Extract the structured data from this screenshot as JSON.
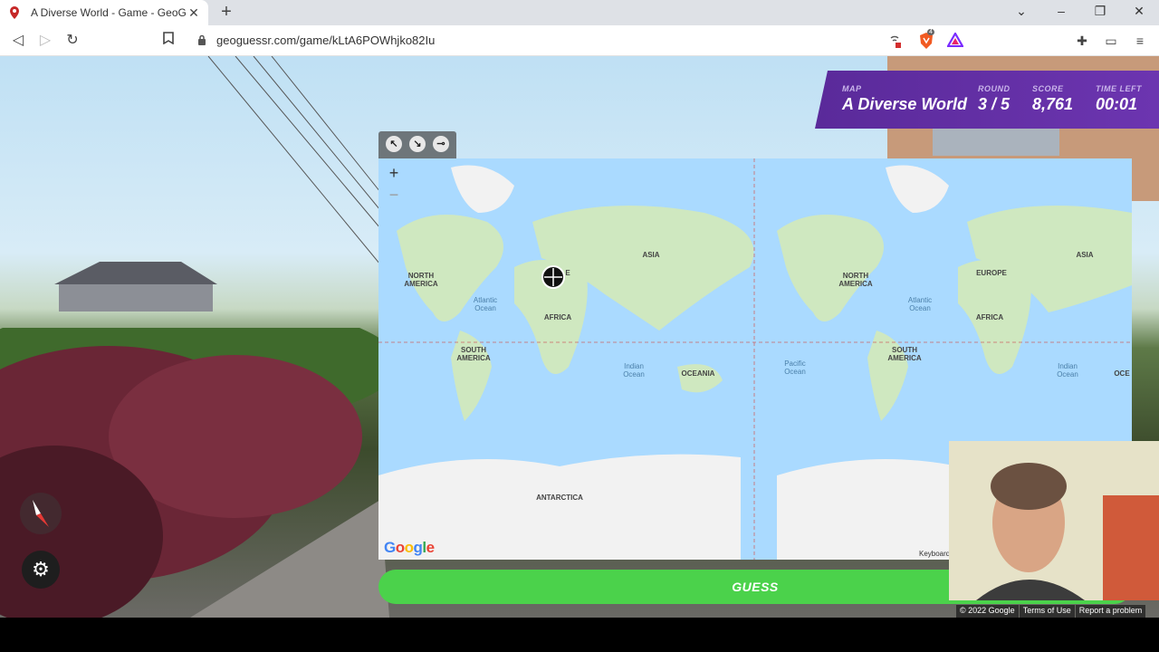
{
  "browser": {
    "tab_title": "A Diverse World - Game - GeoGu",
    "url": "geoguessr.com/game/kLtA6POWhjko82Iu",
    "brave_badge": "4"
  },
  "hud": {
    "map_label": "MAP",
    "map_value": "A Diverse World",
    "round_label": "ROUND",
    "round_value": "3 / 5",
    "score_label": "SCORE",
    "score_value": "8,761",
    "time_label": "TIME LEFT",
    "time_value": "00:01"
  },
  "map": {
    "labels": {
      "north_america": "NORTH AMERICA",
      "south_america": "SOUTH AMERICA",
      "africa": "AFRICA",
      "asia": "ASIA",
      "europe": "EUROPE",
      "oceania": "OCEANIA",
      "antarctica": "ANTARCTICA",
      "atlantic": "Atlantic Ocean",
      "indian": "Indian Ocean",
      "pacific": "Pacific Ocean",
      "europe_partial": "E",
      "oceania_partial": "OCE"
    },
    "google": "Google",
    "keyboard": "Keyboard",
    "zoom_in": "+",
    "zoom_out": "−"
  },
  "guess_button": "GUESS",
  "footer": {
    "copyright": "© 2022 Google",
    "terms": "Terms of Use",
    "report": "Report a problem"
  },
  "colors": {
    "hud_purple": "#6c35b0",
    "guess_green": "#4bd24b",
    "map_water": "#aadaff",
    "land": "#cfe8c0"
  }
}
